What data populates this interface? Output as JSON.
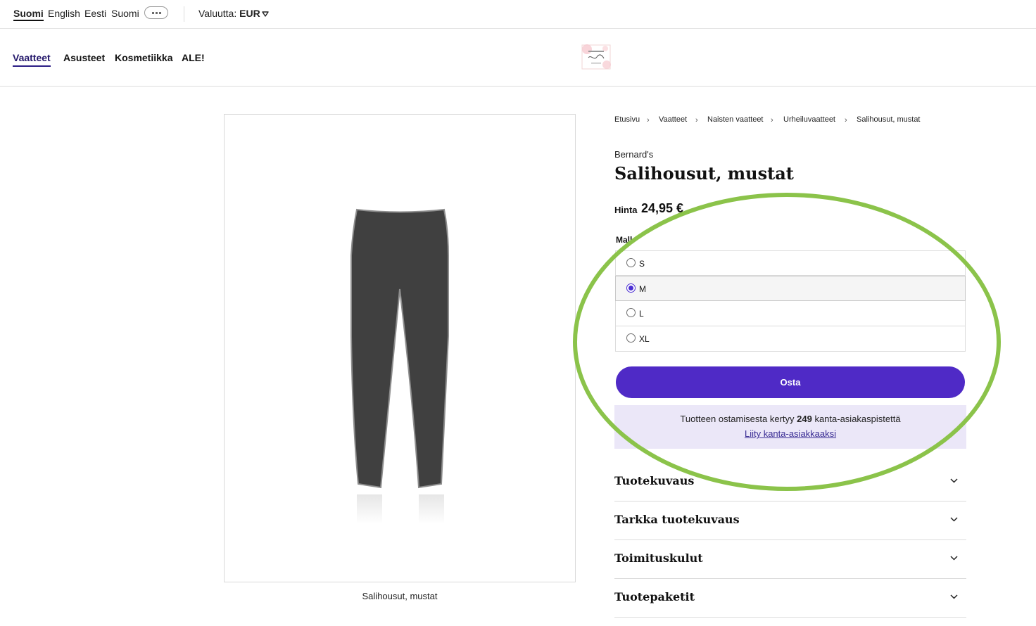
{
  "languages": {
    "selected": "Suomi",
    "items": [
      "Suomi",
      "English",
      "Eesti",
      "Suomi"
    ]
  },
  "currency": {
    "label": "Valuutta:",
    "value": "EUR"
  },
  "nav": {
    "items": [
      "Vaatteet",
      "Asusteet",
      "Kosmetiikka",
      "ALE!"
    ],
    "active": "Vaatteet"
  },
  "breadcrumb": [
    "Etusivu",
    "Vaatteet",
    "Naisten vaatteet",
    "Urheiluvaatteet",
    "Salihousut, mustat"
  ],
  "product": {
    "brand": "Bernard's",
    "title": "Salihousut, mustat",
    "price_label": "Hinta",
    "price": "24,95 €",
    "image_caption": "Salihousut, mustat",
    "model_label": "Mall",
    "sizes": [
      "S",
      "M",
      "L",
      "XL"
    ],
    "selected_size": "M",
    "buy_label": "Osta"
  },
  "loyalty": {
    "text_before": "Tuotteen ostamisesta kertyy ",
    "points": "249",
    "text_after": " kanta-asiakaspistettä",
    "link": "Liity kanta-asiakkaaksi"
  },
  "accordions": [
    "Tuotekuvaus",
    "Tarkka tuotekuvaus",
    "Toimituskulut",
    "Tuotepaketit"
  ],
  "colors": {
    "accent": "#4f2ac6",
    "loyalty_bg": "#ebe7f8",
    "highlight": "#8bc34a"
  }
}
